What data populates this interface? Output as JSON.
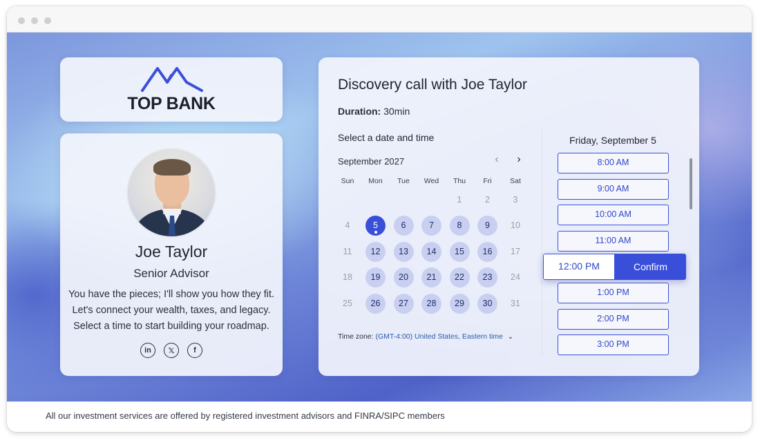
{
  "brand": {
    "name": "TOP BANK",
    "accent": "#3a4fd9",
    "logo_icon": "mountain-peaks-icon"
  },
  "advisor": {
    "name": "Joe Taylor",
    "role": "Senior Advisor",
    "bio": "You have the pieces; I'll show you how they fit. Let's connect your wealth, taxes, and legacy. Select a time to start building your roadmap.",
    "socials": [
      {
        "icon": "linkedin-icon",
        "glyph": "in"
      },
      {
        "icon": "x-icon",
        "glyph": "𝕏"
      },
      {
        "icon": "facebook-icon",
        "glyph": "f"
      }
    ]
  },
  "booking": {
    "title": "Discovery call with Joe Taylor",
    "duration_label": "Duration:",
    "duration_value": "30min",
    "select_label": "Select a date and time",
    "month": "September 2027",
    "weekdays": [
      "Sun",
      "Mon",
      "Tue",
      "Wed",
      "Thu",
      "Fri",
      "Sat"
    ],
    "weeks": [
      [
        null,
        null,
        null,
        null,
        1,
        2,
        3
      ],
      [
        4,
        5,
        6,
        7,
        8,
        9,
        10
      ],
      [
        11,
        12,
        13,
        14,
        15,
        16,
        17
      ],
      [
        18,
        19,
        20,
        21,
        22,
        23,
        24
      ],
      [
        25,
        26,
        27,
        28,
        29,
        30,
        31
      ]
    ],
    "available_days": [
      5,
      6,
      7,
      8,
      9,
      12,
      13,
      14,
      15,
      16,
      19,
      20,
      21,
      22,
      23,
      26,
      27,
      28,
      29,
      30
    ],
    "selected_day": 5,
    "timezone_label": "Time zone:",
    "timezone_value": "(GMT-4:00) United States, Eastern time",
    "day_heading": "Friday, September 5",
    "slots_before": [
      "8:00 AM",
      "9:00 AM",
      "10:00 AM",
      "11:00 AM"
    ],
    "selected_slot": "12:00 PM",
    "confirm_label": "Confirm",
    "slots_after": [
      "1:00 PM",
      "2:00 PM",
      "3:00 PM"
    ]
  },
  "footer": {
    "text": "All our investment services are offered by registered investment advisors and FINRA/SIPC members"
  }
}
